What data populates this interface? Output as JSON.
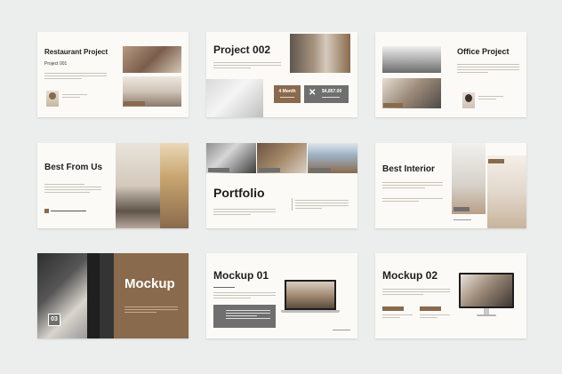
{
  "slides": {
    "s1": {
      "title": "Restaurant Project",
      "subtitle": "Project 001"
    },
    "s2": {
      "title": "Project 002",
      "stat1_value": "4 Month",
      "stat2_value": "$4,857.00"
    },
    "s3": {
      "title": "Office Project"
    },
    "s4": {
      "title": "Best From Us"
    },
    "s5": {
      "title": "Portfolio"
    },
    "s6": {
      "title": "Best Interior"
    },
    "s7": {
      "title": "Mockup",
      "number": "03"
    },
    "s8": {
      "title": "Mockup 01"
    },
    "s9": {
      "title": "Mockup 02"
    }
  },
  "colors": {
    "accent_brown": "#8a6a4c",
    "gray_box": "#6f6f6f",
    "slide_bg": "#fbfaf6",
    "page_bg": "#eceded"
  },
  "icons": {
    "close": "close-icon"
  }
}
